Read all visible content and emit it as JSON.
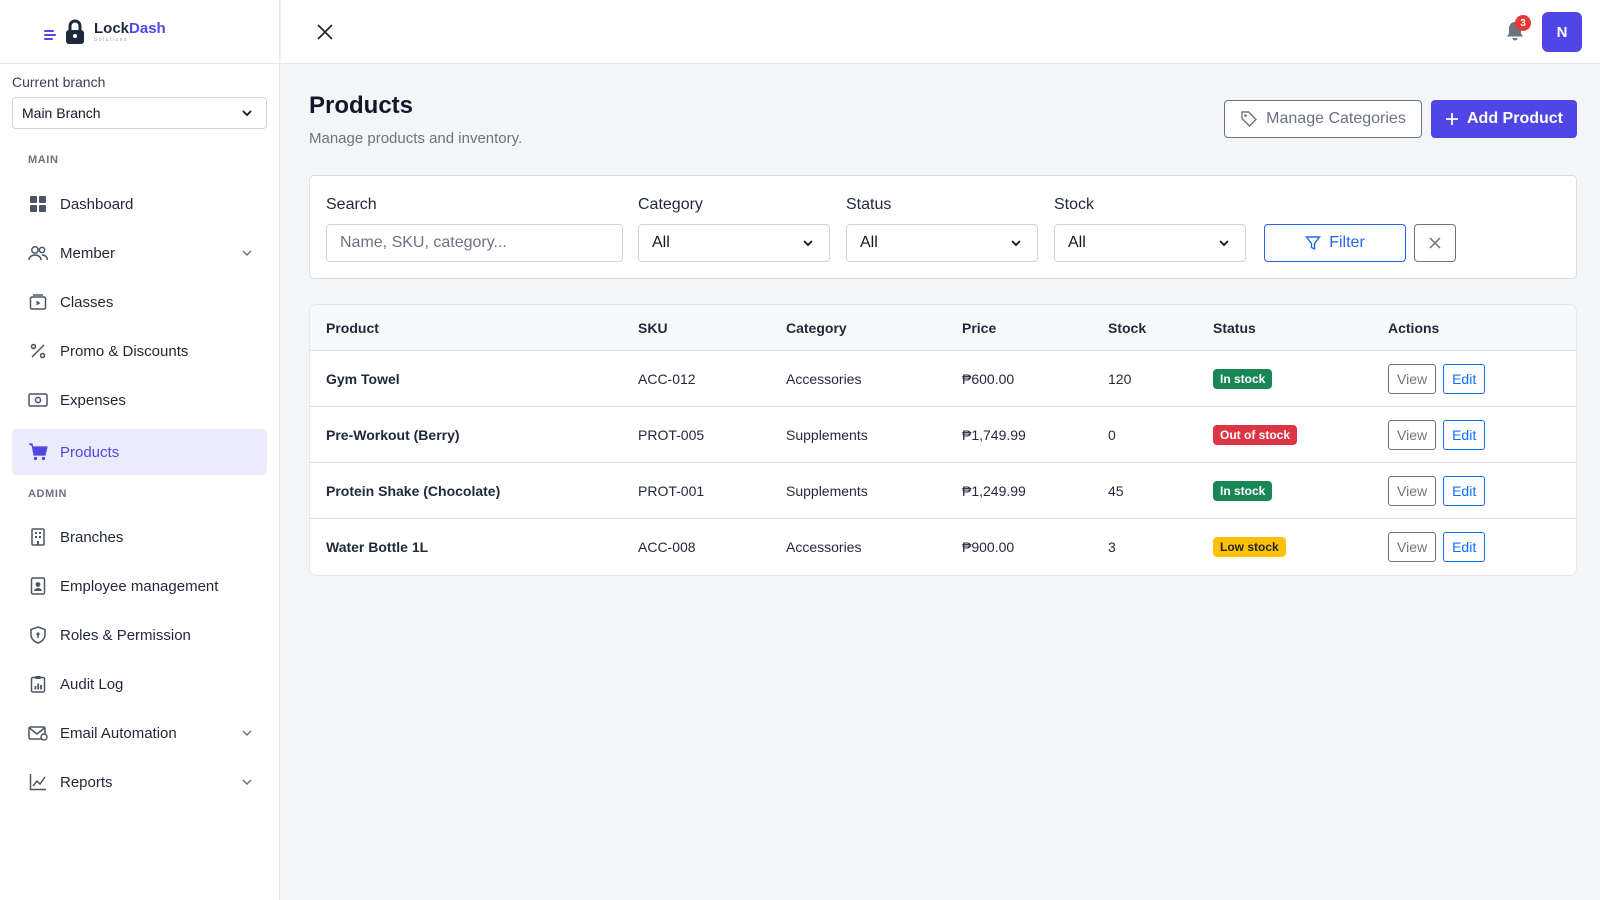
{
  "brand": {
    "name_a": "Lock",
    "name_b": "Dash",
    "sub": "Solutions"
  },
  "branch": {
    "label": "Current branch",
    "value": "Main Branch"
  },
  "sidebar": {
    "main_label": "MAIN",
    "admin_label": "ADMIN",
    "main_items": [
      {
        "label": "Dashboard"
      },
      {
        "label": "Member"
      },
      {
        "label": "Classes"
      },
      {
        "label": "Promo & Discounts"
      },
      {
        "label": "Expenses"
      },
      {
        "label": "Products"
      }
    ],
    "admin_items": [
      {
        "label": "Branches"
      },
      {
        "label": "Employee management"
      },
      {
        "label": "Roles & Permission"
      },
      {
        "label": "Audit Log"
      },
      {
        "label": "Email Automation"
      },
      {
        "label": "Reports"
      }
    ]
  },
  "topbar": {
    "notification_count": "3",
    "avatar_initial": "N"
  },
  "page": {
    "title": "Products",
    "subtitle": "Manage products and inventory.",
    "manage_categories": "Manage Categories",
    "add_product": "Add Product"
  },
  "filters": {
    "search_label": "Search",
    "search_placeholder": "Name, SKU, category...",
    "category_label": "Category",
    "category_value": "All",
    "status_label": "Status",
    "status_value": "All",
    "stock_label": "Stock",
    "stock_value": "All",
    "filter_button": "Filter"
  },
  "table": {
    "headers": [
      "Product",
      "SKU",
      "Category",
      "Price",
      "Stock",
      "Status",
      "Actions"
    ],
    "view_label": "View",
    "edit_label": "Edit",
    "rows": [
      {
        "product": "Gym Towel",
        "sku": "ACC-012",
        "category": "Accessories",
        "price": "₱600.00",
        "stock": "120",
        "status": "In stock"
      },
      {
        "product": "Pre-Workout (Berry)",
        "sku": "PROT-005",
        "category": "Supplements",
        "price": "₱1,749.99",
        "stock": "0",
        "status": "Out of stock"
      },
      {
        "product": "Protein Shake (Chocolate)",
        "sku": "PROT-001",
        "category": "Supplements",
        "price": "₱1,249.99",
        "stock": "45",
        "status": "In stock"
      },
      {
        "product": "Water Bottle 1L",
        "sku": "ACC-008",
        "category": "Accessories",
        "price": "₱900.00",
        "stock": "3",
        "status": "Low stock"
      }
    ]
  },
  "colors": {
    "accent": "#4f46e5",
    "success": "#198754",
    "danger": "#dc3545",
    "warning": "#ffc107",
    "link": "#0d6efd"
  }
}
